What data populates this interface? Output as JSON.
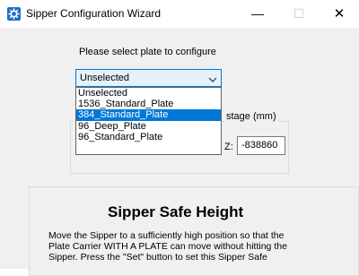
{
  "window": {
    "title": "Sipper Configuration Wizard",
    "controls": {
      "minimize": "—",
      "maximize": "☐",
      "close": "✕"
    }
  },
  "plate_select": {
    "prompt": "Please select plate to configure",
    "selected_value": "Unselected",
    "options": [
      "Unselected",
      "1536_Standard_Plate",
      "384_Standard_Plate",
      "96_Deep_Plate",
      "96_Standard_Plate"
    ],
    "highlighted_option": "384_Standard_Plate"
  },
  "stage_group": {
    "legend": "stage (mm)",
    "z_label": "Z:",
    "z_value": "-838860"
  },
  "safe_height": {
    "title": "Sipper Safe Height",
    "description_lines": [
      "Move the Sipper to a sufficiently high position so that the",
      "Plate Carrier WITH A PLATE can move without hitting the",
      "Sipper. Press the \"Set\" button to set this Sipper Safe"
    ]
  },
  "colors": {
    "accent": "#0078d7",
    "window_bg": "#f0f0f0",
    "icon_blue": "#1e6fc8"
  },
  "icons": {
    "app": "gear-icon",
    "dropdown": "chevron-down-icon"
  }
}
